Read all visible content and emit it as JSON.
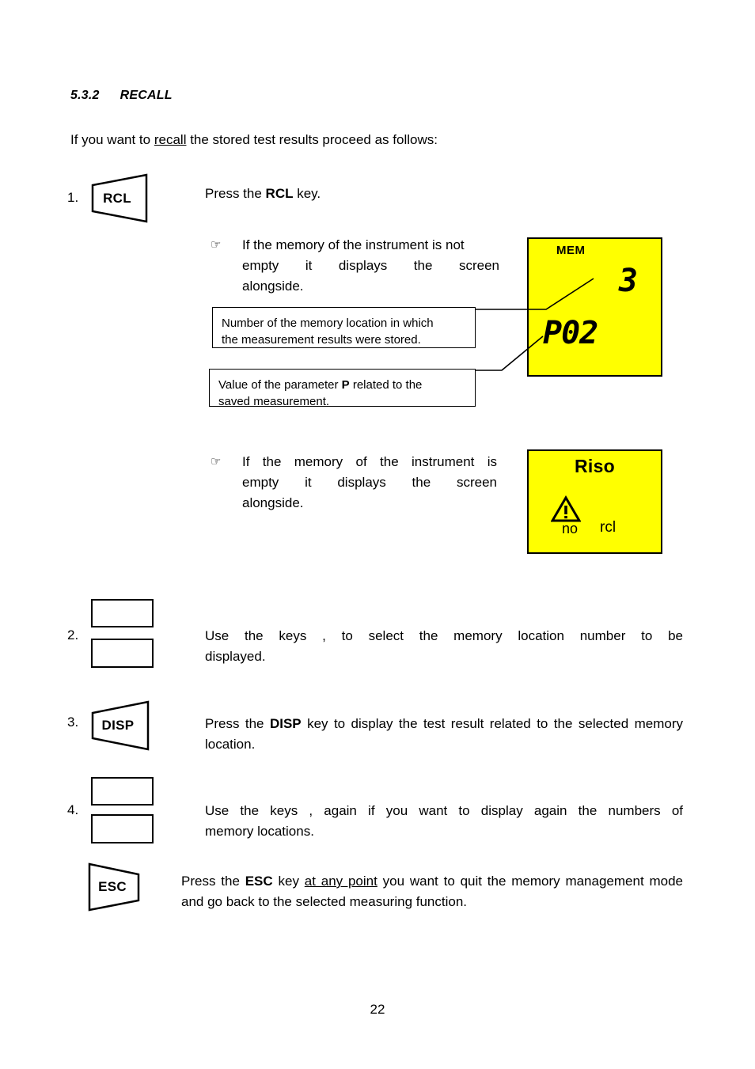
{
  "document": {
    "section_number": "5.3.2",
    "section_title": "RECALL",
    "intro_pre": "If you want to ",
    "intro_underlined": "recall",
    "intro_post": " the stored test results proceed as follows:",
    "page_number": "22"
  },
  "steps": [
    {
      "number": "1.",
      "key_label": "RCL",
      "key_shape": "trapezoid-right",
      "text_pre": "Press the ",
      "text_bold": "RCL",
      "text_post": " key."
    },
    {
      "number": "2.",
      "key_label": "",
      "key_shape": "double-rect",
      "text_line1": "Use the keys    ,      to select the memory location number to be",
      "text_line2": "displayed."
    },
    {
      "number": "3.",
      "key_label": "DISP",
      "key_shape": "trapezoid-right",
      "text_pre": "Press the ",
      "text_bold": "DISP",
      "text_post": " key to display the test result related to the selected memory location."
    },
    {
      "number": "4.",
      "key_label": "",
      "key_shape": "double-rect",
      "text_line1": "Use the keys    ,      again if you want to display again the numbers of",
      "text_line2": "memory locations."
    }
  ],
  "esc_step": {
    "key_label": "ESC",
    "key_shape": "trapezoid-left",
    "text_pre": "Press the ",
    "text_bold": "ESC",
    "text_mid": " key ",
    "text_underlined": "at any point",
    "text_post": " you want to quit the memory management  mode  and go back to the selected measuring function."
  },
  "bullets": [
    {
      "icon": "pointing-hand-icon",
      "glyph": "☞",
      "line1": "If the memory of the instrument is not",
      "line2": "empty it displays the screen",
      "line3": "alongside."
    },
    {
      "icon": "pointing-hand-icon",
      "glyph": "☞",
      "line1": "If the memory of the instrument is",
      "line2": "empty it displays the screen",
      "line3": "alongside."
    }
  ],
  "callouts": [
    {
      "line1": "Number of the memory location in which",
      "line2": "the  measurement results were stored."
    },
    {
      "pre": "Value of the parameter ",
      "bold": "P",
      "post": " related to the",
      "line2": "saved measurement."
    }
  ],
  "lcd_displays": [
    {
      "name": "memory-recall-screen",
      "background_color": "#ffff00",
      "mem_label": "MEM",
      "location_number": "3",
      "parameter_value": "P02"
    },
    {
      "name": "empty-memory-screen",
      "background_color": "#ffff00",
      "title": "Riso",
      "warning_icon": "warning-triangle-icon",
      "text_no": "no",
      "text_rcl": "rcl"
    }
  ]
}
